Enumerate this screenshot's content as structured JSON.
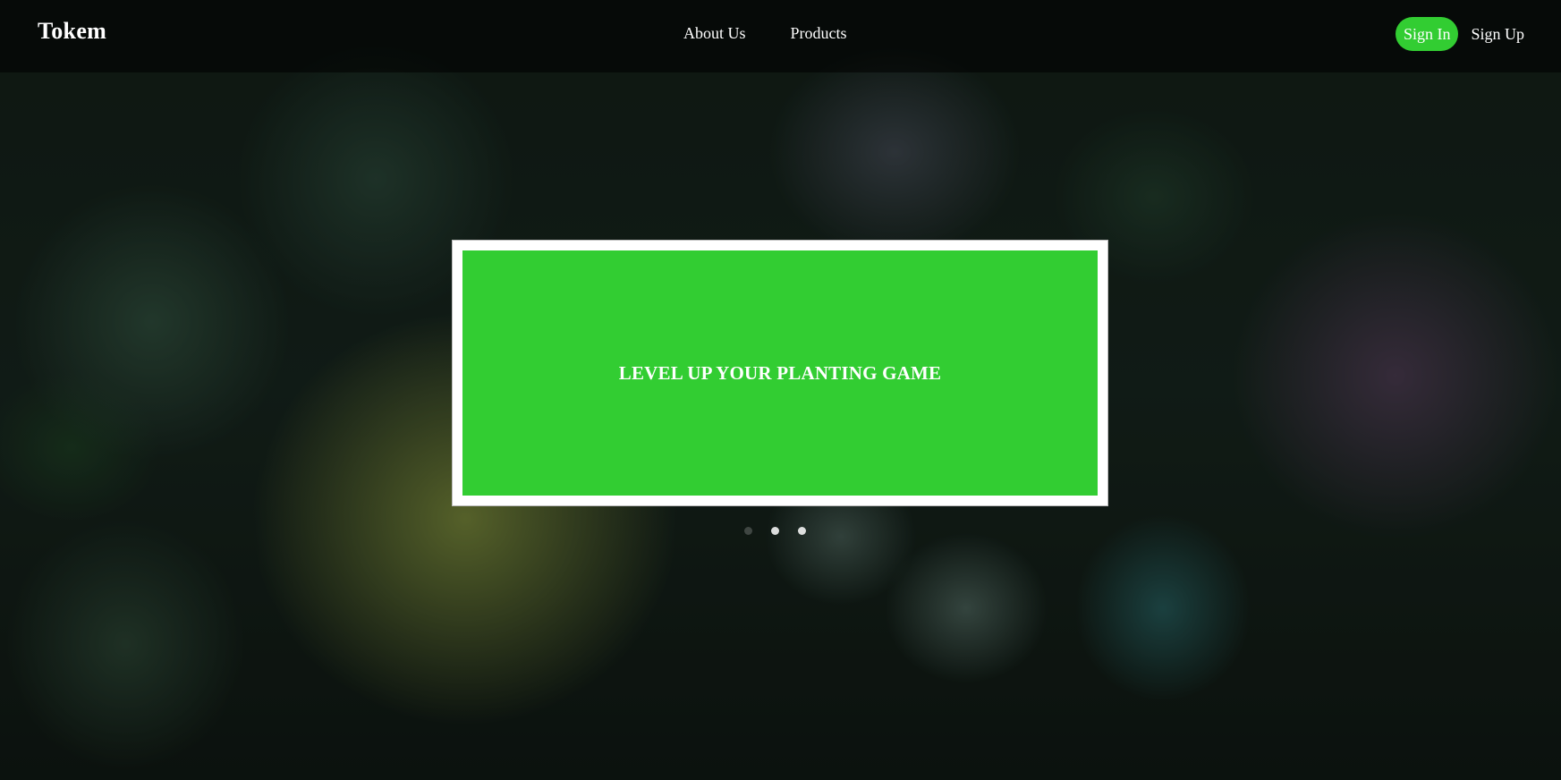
{
  "nav": {
    "brand": "Tokem",
    "links": [
      "About Us",
      "Products"
    ],
    "sign_in": "Sign In",
    "sign_up": "Sign Up"
  },
  "hero": {
    "title": "LEVEL UP YOUR PLANTING GAME",
    "slide_count": 3,
    "active_slide": 1
  },
  "colors": {
    "accent": "#32cd32",
    "nav_background": "rgba(0,0,0,0.55)",
    "text": "#ffffff"
  },
  "background": {
    "image": "succulent-plants-photo"
  }
}
